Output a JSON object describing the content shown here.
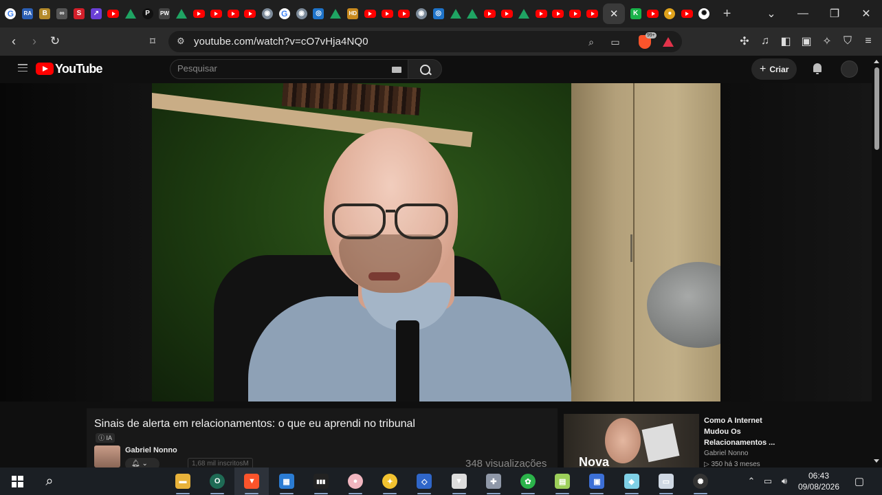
{
  "browser": {
    "tabs": [
      {
        "icon": "google-icon",
        "glyph": "G",
        "kind": "g"
      },
      {
        "icon": "ra-icon",
        "glyph": "RA",
        "color": "#2b5fb4"
      },
      {
        "icon": "b-icon",
        "glyph": "B",
        "color": "#b48a2b"
      },
      {
        "icon": "link-icon",
        "glyph": "∞",
        "color": "#555555"
      },
      {
        "icon": "s-icon",
        "glyph": "S",
        "color": "#d31f2a"
      },
      {
        "icon": "chart-icon",
        "glyph": "↗",
        "color": "#6a3fd6"
      },
      {
        "icon": "youtube-icon",
        "kind": "yt"
      },
      {
        "icon": "drive-icon",
        "kind": "drive"
      },
      {
        "icon": "p-icon",
        "glyph": "P",
        "color": "#111111",
        "round": true
      },
      {
        "icon": "pw-icon",
        "glyph": "PW",
        "color": "#444444"
      },
      {
        "icon": "drive-icon",
        "kind": "drive"
      },
      {
        "icon": "youtube-icon",
        "kind": "yt"
      },
      {
        "icon": "youtube-icon",
        "kind": "yt"
      },
      {
        "icon": "youtube-icon",
        "kind": "yt"
      },
      {
        "icon": "youtube-icon",
        "kind": "yt"
      },
      {
        "icon": "owl-icon",
        "glyph": "◉",
        "color": "#7c8a99",
        "round": true
      },
      {
        "icon": "google-icon",
        "glyph": "G",
        "kind": "g"
      },
      {
        "icon": "owl-icon",
        "glyph": "◉",
        "color": "#7c8a99",
        "round": true
      },
      {
        "icon": "eye-icon",
        "glyph": "◎",
        "color": "#1e73c9"
      },
      {
        "icon": "drive-icon",
        "kind": "drive"
      },
      {
        "icon": "hd-icon",
        "glyph": "HD",
        "color": "#c98a1e"
      },
      {
        "icon": "youtube-icon",
        "kind": "yt"
      },
      {
        "icon": "youtube-icon",
        "kind": "yt"
      },
      {
        "icon": "youtube-icon",
        "kind": "yt"
      },
      {
        "icon": "owl-icon",
        "glyph": "◉",
        "color": "#7c8a99",
        "round": true
      },
      {
        "icon": "eye-icon",
        "glyph": "◎",
        "color": "#1e73c9"
      },
      {
        "icon": "drive-icon",
        "kind": "drive"
      },
      {
        "icon": "drive-icon",
        "kind": "drive"
      },
      {
        "icon": "youtube-icon",
        "kind": "yt"
      },
      {
        "icon": "youtube-icon",
        "kind": "yt"
      },
      {
        "icon": "drive-icon",
        "kind": "drive"
      },
      {
        "icon": "youtube-icon",
        "kind": "yt"
      },
      {
        "icon": "youtube-icon",
        "kind": "yt"
      },
      {
        "icon": "youtube-icon",
        "kind": "yt"
      },
      {
        "icon": "youtube-icon",
        "kind": "yt"
      }
    ],
    "active_tab_icon": "close-icon",
    "tabs_after": [
      {
        "icon": "k-icon",
        "glyph": "K",
        "color": "#19b34a"
      },
      {
        "icon": "youtube-icon",
        "kind": "yt"
      },
      {
        "icon": "coin-icon",
        "glyph": "●",
        "color": "#e0a31c",
        "round": true
      },
      {
        "icon": "youtube-icon",
        "kind": "yt"
      },
      {
        "icon": "openai-icon",
        "glyph": "✺",
        "color": "#ffffff",
        "fg": "#111111",
        "round": true
      }
    ],
    "url": "youtube.com/watch?v=cO7vHja4NQ0",
    "shield_badge": "99+"
  },
  "youtube": {
    "logo_text": "YouTube",
    "search_placeholder": "Pesquisar",
    "create_label": "Criar",
    "video": {
      "title": "Sinais de alerta em relacionamentos: o que eu aprendi no tribunal",
      "ai_badge": "IA",
      "channel_name": "Gabriel Nonno",
      "subscribers": "1,68 mil inscritosM",
      "views": "348 visualizações"
    },
    "related": {
      "thumb_text": "Nova",
      "title": "Como A Internet Mudou Os Relacionamentos ...",
      "channel": "Gabriel Nonno",
      "meta": "▷  350   há 3 meses"
    }
  },
  "taskbar": {
    "time": "06:43",
    "date": "09/08/2026",
    "apps": [
      {
        "icon": "file-explorer-icon",
        "glyph": "▬",
        "color": "#e8b23a"
      },
      {
        "icon": "opera-gx-icon",
        "glyph": "O",
        "color": "#1f6b55",
        "round": true
      },
      {
        "icon": "brave-icon",
        "glyph": "▼",
        "color": "#fb542b"
      },
      {
        "icon": "microsoft-store-icon",
        "glyph": "▦",
        "color": "#2b7cd3"
      },
      {
        "icon": "audio-levels-icon",
        "glyph": "▮▮▮",
        "color": "#222222"
      },
      {
        "icon": "pig-icon",
        "glyph": "●",
        "color": "#f1b6c0",
        "round": true
      },
      {
        "icon": "bee-icon",
        "glyph": "✦",
        "color": "#f2c230",
        "round": true
      },
      {
        "icon": "vm-icon",
        "glyph": "◇",
        "color": "#2f66c9"
      },
      {
        "icon": "fox-icon",
        "glyph": "▼",
        "color": "#dddddd"
      },
      {
        "icon": "gamepad-icon",
        "glyph": "✚",
        "color": "#8f98a8"
      },
      {
        "icon": "recycle-icon",
        "glyph": "✿",
        "color": "#2bb34a",
        "round": true
      },
      {
        "icon": "archive-icon",
        "glyph": "▤",
        "color": "#9ccf5a"
      },
      {
        "icon": "notepad-icon",
        "glyph": "▣",
        "color": "#3c6fd6"
      },
      {
        "icon": "eraser-icon",
        "glyph": "◆",
        "color": "#7fd0e6"
      },
      {
        "icon": "window-icon",
        "glyph": "▭",
        "color": "#cfd8e3"
      },
      {
        "icon": "openai-icon",
        "glyph": "✺",
        "color": "#333333",
        "round": true
      }
    ]
  }
}
